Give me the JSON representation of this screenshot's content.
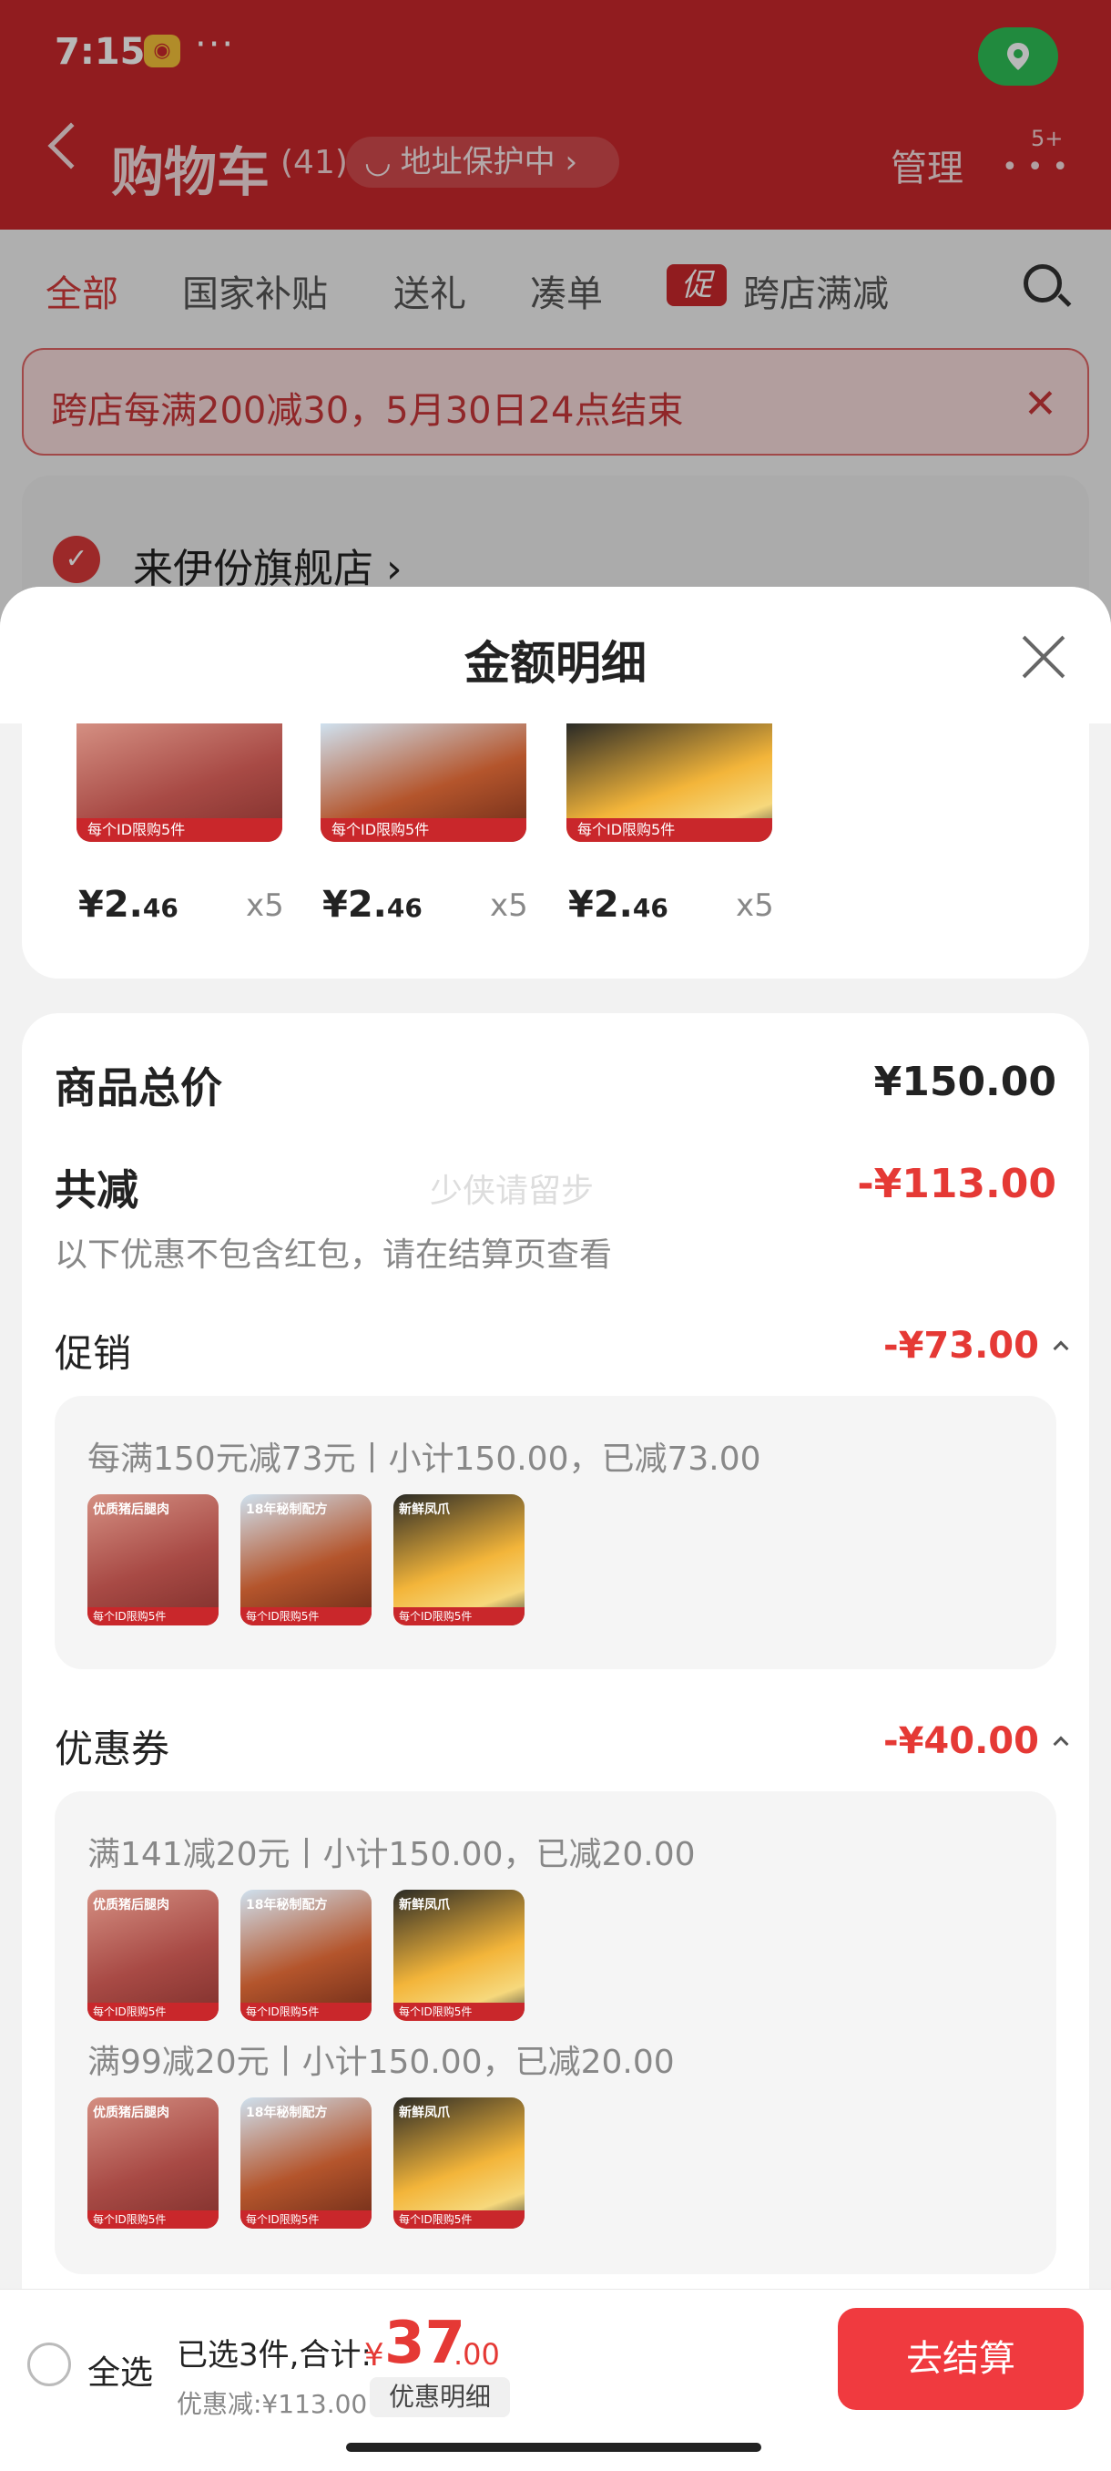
{
  "status_bar": {
    "time": "7:15",
    "dots": "···"
  },
  "header": {
    "title": "购物车",
    "count": "(41)",
    "address_protect": "地址保护中 ›",
    "manage": "管理",
    "more_badge": "5+"
  },
  "tabs": [
    "全部",
    "国家补贴",
    "送礼",
    "凑单",
    "跨店满减"
  ],
  "promo_icon_label": "促",
  "promo_banner": "跨店每满200减30，5月30日24点结束",
  "store": {
    "name": "来伊份旗舰店 ›"
  },
  "sheet": {
    "title": "金额明细",
    "products": [
      {
        "price_int": "¥2.",
        "price_dec": "46",
        "qty": "x5",
        "tag": "每个ID限购5件"
      },
      {
        "price_int": "¥2.",
        "price_dec": "46",
        "qty": "x5",
        "tag": "每个ID限购5件"
      },
      {
        "price_int": "¥2.",
        "price_dec": "46",
        "qty": "x5",
        "tag": "每个ID限购5件"
      }
    ],
    "total_label": "商品总价",
    "total_value": "¥150.00",
    "reduce_label": "共减",
    "reduce_value": "-¥113.00",
    "reduce_note": "以下优惠不包含红包，请在结算页查看",
    "watermark": "少侠请留步",
    "promo_section": {
      "label": "促销",
      "value": "-¥73.00",
      "rule": "每满150元减73元丨小计150.00，已减73.00"
    },
    "coupon_section": {
      "label": "优惠券",
      "value": "-¥40.00",
      "rules": [
        "满141减20元丨小计150.00，已减20.00",
        "满99减20元丨小计150.00，已减20.00"
      ]
    },
    "thumb_titles": [
      "优质猪后腿肉",
      "18年秘制配方",
      "新鲜凤爪"
    ],
    "thumb_tag": "每个ID限购5件"
  },
  "bottom_bar": {
    "select_all": "全选",
    "summary": "已选3件,合计:",
    "currency": "¥",
    "total_int": "37",
    "total_dec": ".00",
    "discount": "优惠减:¥113.00",
    "detail_btn": "优惠明细",
    "checkout": "去结算"
  },
  "colors": {
    "brand_red": "#c9272b",
    "price_red": "#e53935",
    "checkout_red": "#f03a3f"
  }
}
